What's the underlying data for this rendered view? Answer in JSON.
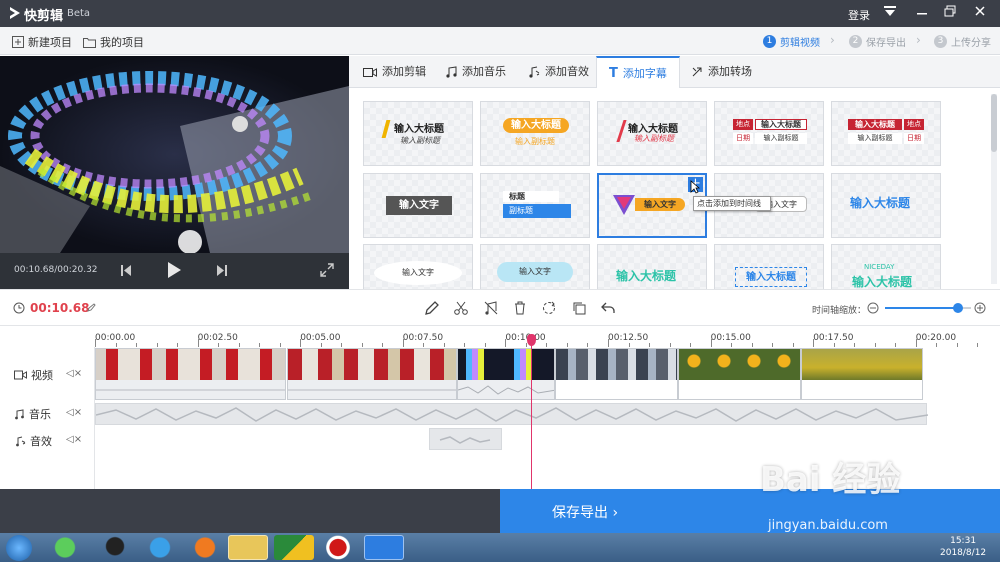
{
  "app": {
    "name": "快剪辑",
    "edition": "Beta",
    "login": "登录"
  },
  "project_bar": {
    "new_project": "新建项目",
    "my_projects": "我的项目"
  },
  "steps": [
    {
      "num": "1",
      "label": "剪辑视频"
    },
    {
      "num": "2",
      "label": "保存导出"
    },
    {
      "num": "3",
      "label": "上传分享"
    }
  ],
  "preview": {
    "time": "00:10.68/00:20.32"
  },
  "tabs": [
    {
      "label": "添加剪辑"
    },
    {
      "label": "添加音乐"
    },
    {
      "label": "添加音效"
    },
    {
      "label": "添加字幕"
    },
    {
      "label": "添加转场"
    }
  ],
  "templates": {
    "row1": [
      {
        "title": "输入大标题",
        "sub": "输入副标题"
      },
      {
        "title": "输入大标题",
        "sub": "输入副标题"
      },
      {
        "title": "输入大标题",
        "sub": "输入副标题"
      },
      {
        "tag1": "地点",
        "title": "输入大标题",
        "tag2": "日期",
        "sub": "输入副标题"
      },
      {
        "title": "输入大标题",
        "tag1": "地点",
        "sub": "输入副标题",
        "tag2": "日期"
      }
    ],
    "row2": [
      {
        "title": "输入文字"
      },
      {
        "title": "标题",
        "sub": "副标题"
      },
      {
        "title": "输入文字"
      },
      {
        "title": "输入文字"
      },
      {
        "title": "输入大标题"
      }
    ],
    "row3": [
      {
        "title": "输入文字"
      },
      {
        "title": "输入文字"
      },
      {
        "title": "输入大标题"
      },
      {
        "title": "输入大标题"
      },
      {
        "tag": "NICEDAY",
        "title": "输入大标题"
      }
    ],
    "tooltip": "点击添加到时间线",
    "add_icon": "+"
  },
  "timeline": {
    "current_time": "00:10.68",
    "zoom_label": "时间轴缩放：",
    "zoom_level": 0.85,
    "ticks": [
      "00:00.00",
      "00:02.50",
      "00:05.00",
      "00:07.50",
      "00:10.00",
      "00:12.50",
      "00:15.00",
      "00:17.50",
      "00:20.00"
    ],
    "tracks": [
      {
        "label": "视频"
      },
      {
        "label": "音乐"
      },
      {
        "label": "音效"
      }
    ]
  },
  "export": {
    "label": "保存导出 ›"
  },
  "taskbar": {
    "time": "15:31",
    "date": "2018/8/12"
  },
  "watermark": {
    "brand": "Bai 经验",
    "url": "jingyan.baidu.com"
  },
  "colors": {
    "accent": "#2d7de0",
    "time_red": "#e0424d",
    "playhead": "#e0356b",
    "dark": "#3b3f48"
  }
}
